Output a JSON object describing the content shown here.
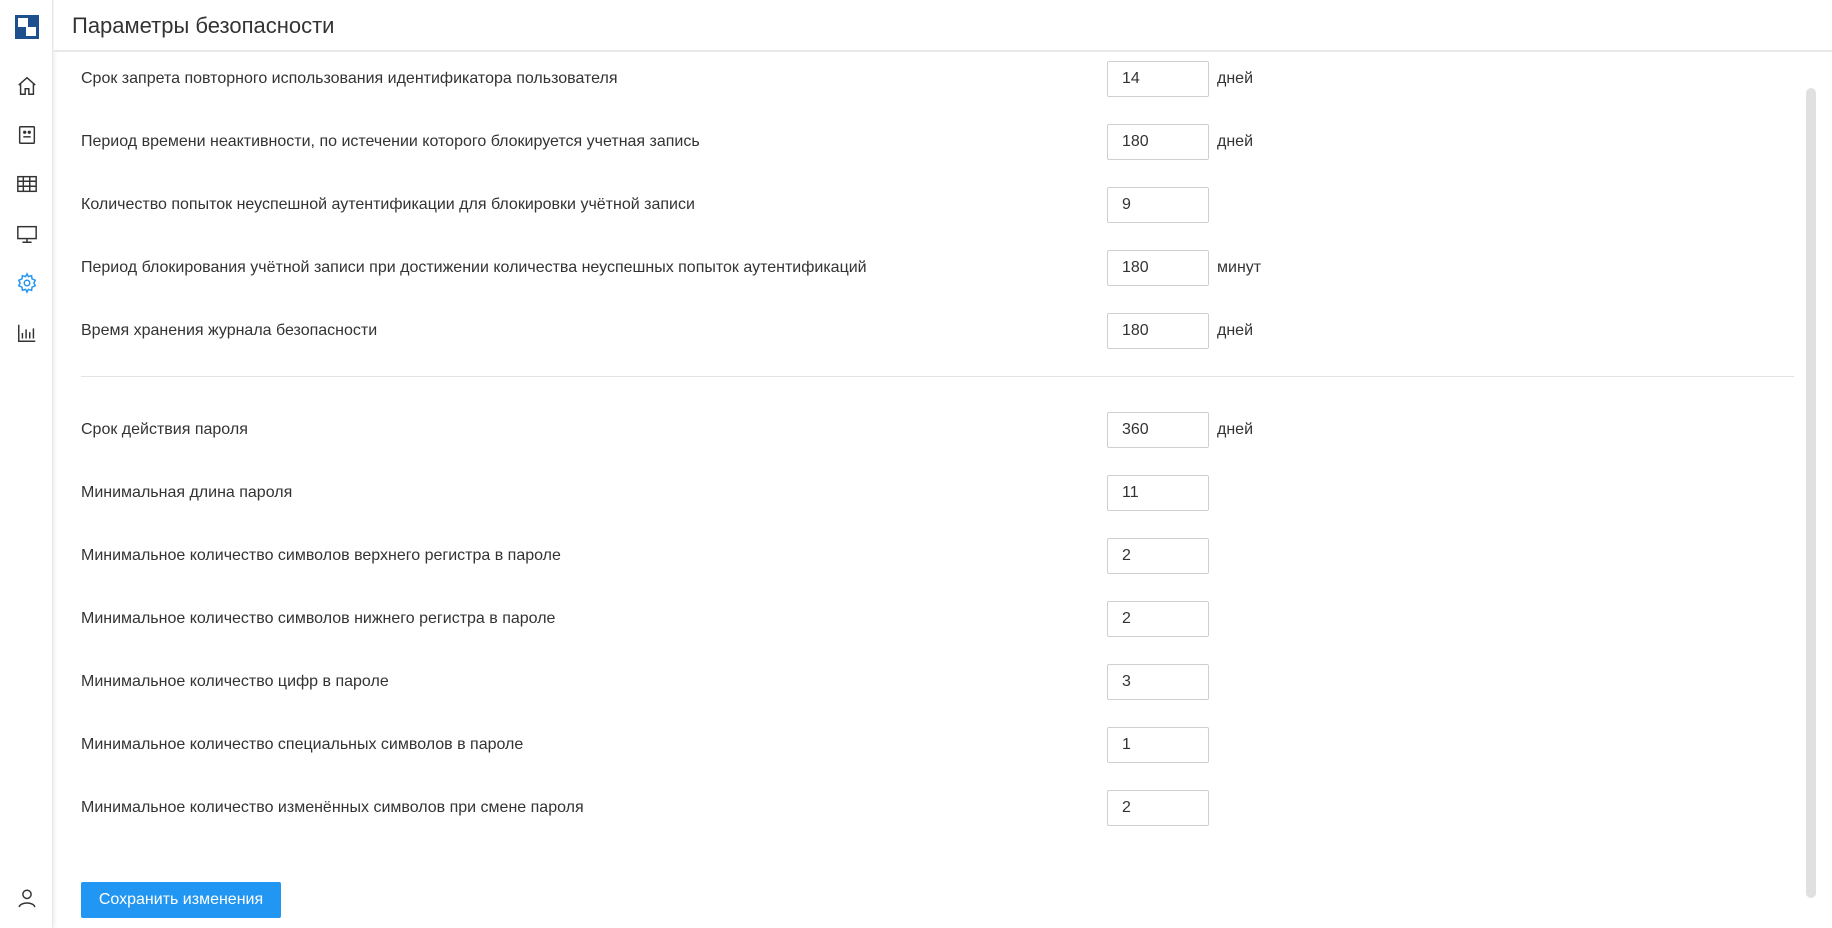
{
  "header": {
    "title": "Параметры безопасности"
  },
  "sidebar": {
    "items": [
      {
        "icon": "home-icon"
      },
      {
        "icon": "user-card-icon"
      },
      {
        "icon": "table-icon"
      },
      {
        "icon": "monitor-icon"
      },
      {
        "icon": "gear-icon",
        "active": true
      },
      {
        "icon": "bar-chart-icon"
      },
      {
        "icon": "user-icon"
      }
    ]
  },
  "settings": {
    "group1": [
      {
        "label": "Срок запрета повторного использования идентификатора пользователя",
        "value": "14",
        "unit": "дней"
      },
      {
        "label": "Период времени неактивности, по истечении которого блокируется учетная запись",
        "value": "180",
        "unit": "дней"
      },
      {
        "label": "Количество попыток неуспешной аутентификации для блокировки учётной записи",
        "value": "9",
        "unit": ""
      },
      {
        "label": "Период блокирования учётной записи при достижении количества неуспешных попыток аутентификаций",
        "value": "180",
        "unit": "минут"
      },
      {
        "label": "Время хранения журнала безопасности",
        "value": "180",
        "unit": "дней"
      }
    ],
    "group2": [
      {
        "label": "Срок действия пароля",
        "value": "360",
        "unit": "дней"
      },
      {
        "label": "Минимальная длина пароля",
        "value": "11",
        "unit": ""
      },
      {
        "label": "Минимальное количество символов верхнего регистра в пароле",
        "value": "2",
        "unit": ""
      },
      {
        "label": "Минимальное количество символов нижнего регистра в пароле",
        "value": "2",
        "unit": ""
      },
      {
        "label": "Минимальное количество цифр в пароле",
        "value": "3",
        "unit": ""
      },
      {
        "label": "Минимальное количество специальных символов в пароле",
        "value": "1",
        "unit": ""
      },
      {
        "label": "Минимальное количество изменённых символов при смене пароля",
        "value": "2",
        "unit": ""
      }
    ]
  },
  "actions": {
    "save_label": "Сохранить изменения"
  },
  "colors": {
    "accent": "#2196f3",
    "logo": "#1e4f8f"
  }
}
